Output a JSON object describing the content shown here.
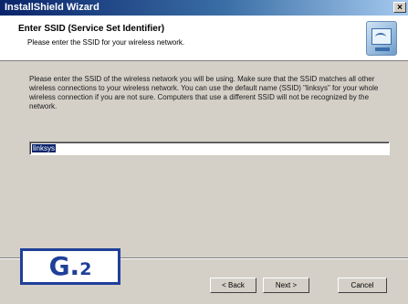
{
  "window": {
    "title": "InstallShield Wizard",
    "close_glyph": "×"
  },
  "header": {
    "title": "Enter SSID (Service Set Identifier)",
    "subtitle": "Please enter the SSID for your wireless network.",
    "icon": "wireless-network-icon"
  },
  "body": {
    "description": "Please enter the SSID of the wireless network you will be using. Make sure that the SSID matches all other wireless connections to your wireless network. You can use the default name (SSID) \"linksys\" for your whole wireless connection if you are not sure. Computers that use a different SSID will not be recognized by the network."
  },
  "ssid_field": {
    "value": "linksys"
  },
  "buttons": {
    "back": "< Back",
    "next": "Next >",
    "cancel": "Cancel"
  },
  "badge": {
    "letter": "G.",
    "number": "2",
    "color": "#1f3f99"
  }
}
